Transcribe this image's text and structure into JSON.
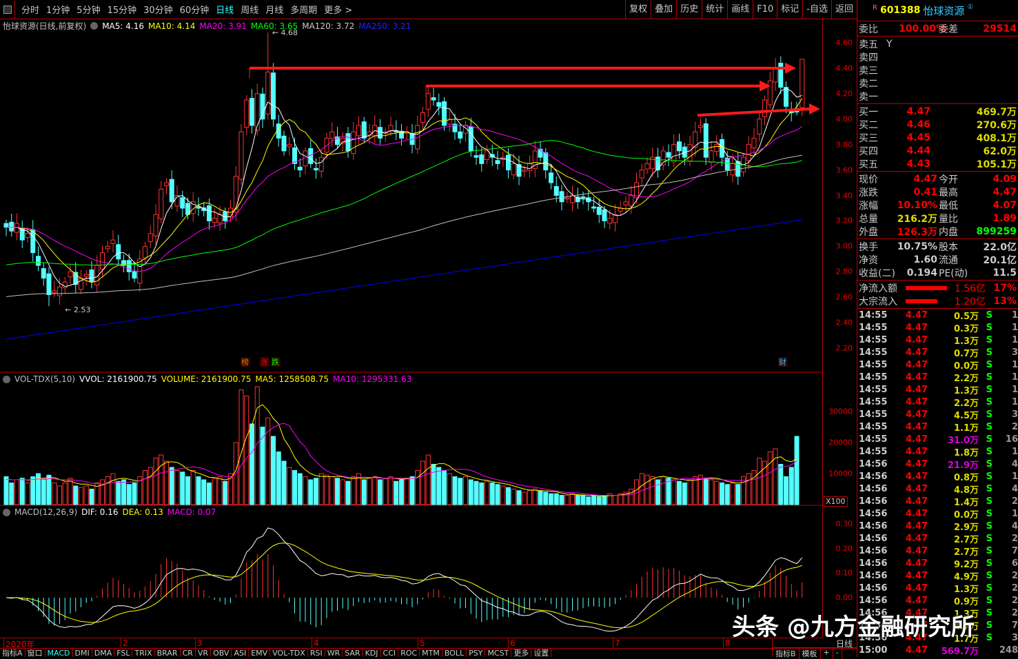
{
  "toolbar": {
    "periods": [
      "分时",
      "1分钟",
      "5分钟",
      "15分钟",
      "30分钟",
      "60分钟",
      "日线",
      "周线",
      "月线",
      "多周期",
      "更多 >"
    ],
    "active": "日线",
    "tools": [
      "复权",
      "叠加",
      "历史",
      "统计",
      "画线",
      "F10",
      "标记",
      "-自选",
      "返回"
    ]
  },
  "legend": {
    "title": "怡球资源(日线,前复权)",
    "ma5": "MA5: 4.16",
    "ma10": "MA10: 4.14",
    "ma20": "MA20: 3.91",
    "ma60": "MA60: 3.65",
    "ma120": "MA120: 3.72",
    "ma250": "MA250: 3.21",
    "high_mark": "4.68",
    "low_mark": "2.53",
    "markers": [
      "榜",
      "涨",
      "跌",
      "财"
    ]
  },
  "vol_legend": {
    "name": "VOL-TDX(5,10)",
    "vvol": "VVOL: 2161900.75",
    "volume": "VOLUME: 2161900.75",
    "ma5": "MA5: 1258508.75",
    "ma10": "MA10: 1295331.63",
    "unit": "X100"
  },
  "macd_legend": {
    "name": "MACD(12,26,9)",
    "dif": "DIF: 0.16",
    "dea": "DEA: 0.13",
    "macd": "MACD: 0.07"
  },
  "price_axis": [
    "4.60",
    "4.40",
    "4.20",
    "4.00",
    "3.80",
    "3.60",
    "3.40",
    "3.20",
    "3.00",
    "2.80",
    "2.60",
    "2.40",
    "2.20"
  ],
  "vol_axis": [
    "30000",
    "20000",
    "10000"
  ],
  "macd_axis": [
    "0.30",
    "0.20",
    "0.10",
    "0.00"
  ],
  "dates": [
    "2020年",
    "2",
    "3",
    "4",
    "5",
    "6",
    "7",
    "8"
  ],
  "bottom_tabs": [
    "指标A",
    "窗口",
    "MACD",
    "DMI",
    "DMA",
    "FSL",
    "TRIX",
    "BRAR",
    "CR",
    "VR",
    "OBV",
    "ASI",
    "EMV",
    "VOL-TDX",
    "RSI",
    "WR",
    "SAR",
    "KDJ",
    "CCI",
    "ROC",
    "MTM",
    "BOLL",
    "PSY",
    "MCST",
    "更多",
    "设置"
  ],
  "bottom_right": {
    "period": "日线",
    "tabs": [
      "指标B",
      "模板",
      "+",
      "-"
    ]
  },
  "colors": {
    "up": "#ff3232",
    "down": "#54ffff",
    "ma5": "#ffffff",
    "ma10": "#ffff00",
    "ma20": "#ff00ff",
    "ma60": "#00ff00",
    "ma120": "#c0c0c0",
    "ma250": "#0000ff",
    "arrow": "#ff1a1a"
  },
  "chart_data": {
    "type": "candlestick",
    "closes": [
      3.15,
      3.12,
      3.18,
      3.05,
      3.1,
      2.95,
      2.85,
      2.75,
      2.62,
      2.65,
      2.68,
      2.72,
      2.8,
      2.7,
      2.75,
      2.78,
      2.72,
      2.85,
      2.95,
      3.0,
      3.05,
      2.9,
      2.85,
      2.8,
      2.75,
      2.9,
      3.0,
      3.1,
      3.25,
      3.45,
      3.5,
      3.35,
      3.4,
      3.3,
      3.25,
      3.35,
      3.3,
      3.28,
      3.2,
      3.22,
      3.25,
      3.2,
      3.3,
      3.55,
      3.9,
      4.15,
      3.95,
      4.2,
      4.0,
      4.37,
      4.0,
      3.85,
      3.75,
      3.8,
      3.65,
      3.6,
      3.75,
      3.65,
      3.6,
      3.7,
      3.85,
      3.9,
      3.8,
      3.85,
      3.75,
      3.9,
      3.95,
      3.85,
      3.9,
      3.95,
      3.85,
      3.9,
      3.95,
      3.9,
      3.85,
      3.9,
      3.8,
      3.95,
      4.05,
      4.2,
      4.15,
      4.1,
      3.95,
      4.0,
      3.9,
      3.85,
      3.95,
      3.75,
      3.7,
      3.65,
      3.75,
      3.7,
      3.65,
      3.7,
      3.6,
      3.65,
      3.55,
      3.6,
      3.65,
      3.75,
      3.7,
      3.6,
      3.5,
      3.4,
      3.35,
      3.38,
      3.4,
      3.35,
      3.38,
      3.35,
      3.3,
      3.25,
      3.2,
      3.22,
      3.25,
      3.3,
      3.35,
      3.4,
      3.5,
      3.6,
      3.65,
      3.7,
      3.6,
      3.75,
      3.7,
      3.8,
      3.75,
      3.7,
      3.8,
      3.9,
      3.95,
      3.7,
      3.75,
      3.8,
      3.7,
      3.6,
      3.65,
      3.55,
      3.7,
      3.8,
      3.85,
      4.0,
      4.15,
      4.3,
      4.4,
      4.25,
      4.1,
      4.05,
      4.06,
      4.47
    ],
    "volumes": [
      9000,
      7000,
      8000,
      8500,
      7000,
      9000,
      10000,
      8000,
      9500,
      7000,
      6000,
      7000,
      8500,
      6000,
      5500,
      6000,
      5000,
      7000,
      8000,
      9000,
      10000,
      7500,
      8000,
      6500,
      7000,
      9000,
      11000,
      12000,
      15000,
      16000,
      14000,
      12000,
      11000,
      10500,
      9000,
      11000,
      9000,
      8000,
      7000,
      8500,
      9000,
      7500,
      10000,
      20000,
      37000,
      35000,
      26000,
      38000,
      25000,
      28000,
      22000,
      17000,
      14000,
      12000,
      11000,
      10000,
      9000,
      8000,
      8500,
      10000,
      9500,
      9000,
      8500,
      8000,
      7500,
      9000,
      10000,
      8000,
      8500,
      9000,
      8000,
      8500,
      9000,
      7500,
      8000,
      8500,
      9000,
      11000,
      14000,
      16000,
      13000,
      12000,
      11000,
      10000,
      9000,
      8500,
      9000,
      8000,
      7500,
      7000,
      7500,
      7000,
      6500,
      6000,
      5500,
      5000,
      4500,
      4000,
      4500,
      5000,
      4500,
      4000,
      3500,
      3500,
      3000,
      3000,
      3500,
      3000,
      3000,
      2500,
      2800,
      2500,
      3000,
      3500,
      3000,
      3500,
      4000,
      5000,
      8000,
      10000,
      9500,
      9000,
      8000,
      9000,
      8500,
      8000,
      7500,
      7000,
      8000,
      9000,
      9500,
      8500,
      8000,
      7500,
      7000,
      6500,
      7000,
      6500,
      9000,
      10000,
      11000,
      15000,
      14000,
      17000,
      18000,
      13000,
      9000,
      12000,
      22000
    ],
    "ylim": [
      2.2,
      4.6
    ]
  },
  "quote": {
    "code": "601388",
    "name": "怡球资源",
    "weibi_label": "委比",
    "weibi": "100.00%",
    "weicha_label": "委差",
    "weicha": "29514",
    "sells": [
      {
        "label": "卖五",
        "extra": "Y"
      },
      {
        "label": "卖四"
      },
      {
        "label": "卖三"
      },
      {
        "label": "卖二"
      },
      {
        "label": "卖一"
      }
    ],
    "buys": [
      {
        "label": "买一",
        "price": "4.47",
        "vol": "469.7万"
      },
      {
        "label": "买二",
        "price": "4.46",
        "vol": "270.6万"
      },
      {
        "label": "买三",
        "price": "4.45",
        "vol": "408.1万"
      },
      {
        "label": "买四",
        "price": "4.44",
        "vol": "62.0万"
      },
      {
        "label": "买五",
        "price": "4.43",
        "vol": "105.1万"
      }
    ],
    "stats": [
      [
        "现价",
        "4.47",
        "今开",
        "4.09"
      ],
      [
        "涨跌",
        "0.41",
        "最高",
        "4.47"
      ],
      [
        "涨幅",
        "10.10%",
        "最低",
        "4.07"
      ],
      [
        "总量",
        "216.2万",
        "量比",
        "1.89"
      ],
      [
        "外盘",
        "126.3万",
        "内盘",
        "899259"
      ]
    ],
    "stats2": [
      [
        "换手",
        "10.75%",
        "股本",
        "22.0亿"
      ],
      [
        "净资",
        "1.60",
        "流通",
        "20.1亿"
      ],
      [
        "收益(二)",
        "0.194",
        "PE(动)",
        "11.5"
      ]
    ],
    "flows": [
      {
        "label": "净流入额",
        "value": "1.56亿",
        "pct": "17%",
        "bar": 1.0
      },
      {
        "label": "大宗流入",
        "value": "1.20亿",
        "pct": "13%",
        "bar": 0.77
      }
    ]
  },
  "ticks": [
    [
      "14:55",
      "4.47",
      "0.5万",
      "S",
      "1"
    ],
    [
      "14:55",
      "4.47",
      "0.3万",
      "S",
      "1"
    ],
    [
      "14:55",
      "4.47",
      "1.3万",
      "S",
      "1"
    ],
    [
      "14:55",
      "4.47",
      "0.7万",
      "S",
      "3"
    ],
    [
      "14:55",
      "4.47",
      "0.0万",
      "S",
      "1"
    ],
    [
      "14:55",
      "4.47",
      "2.2万",
      "S",
      "1"
    ],
    [
      "14:55",
      "4.47",
      "1.3万",
      "S",
      "1"
    ],
    [
      "14:55",
      "4.47",
      "2.2万",
      "S",
      "1"
    ],
    [
      "14:55",
      "4.47",
      "4.5万",
      "S",
      "3"
    ],
    [
      "14:55",
      "4.47",
      "1.1万",
      "S",
      "2"
    ],
    [
      "14:55",
      "4.47",
      "31.0万",
      "S",
      "16"
    ],
    [
      "14:55",
      "4.47",
      "1.8万",
      "S",
      "1"
    ],
    [
      "14:56",
      "4.47",
      "21.9万",
      "S",
      "4"
    ],
    [
      "14:56",
      "4.47",
      "0.8万",
      "S",
      "1"
    ],
    [
      "14:56",
      "4.47",
      "4.8万",
      "S",
      "4"
    ],
    [
      "14:56",
      "4.47",
      "1.4万",
      "S",
      "2"
    ],
    [
      "14:56",
      "4.47",
      "0.0万",
      "S",
      "1"
    ],
    [
      "14:56",
      "4.47",
      "2.9万",
      "S",
      "4"
    ],
    [
      "14:56",
      "4.47",
      "2.7万",
      "S",
      "2"
    ],
    [
      "14:56",
      "4.47",
      "2.7万",
      "S",
      "7"
    ],
    [
      "14:56",
      "4.47",
      "9.2万",
      "S",
      "6"
    ],
    [
      "14:56",
      "4.47",
      "4.9万",
      "S",
      "2"
    ],
    [
      "14:56",
      "4.47",
      "1.3万",
      "S",
      "2"
    ],
    [
      "14:56",
      "4.47",
      "0.9万",
      "S",
      "2"
    ],
    [
      "14:56",
      "4.47",
      "1.3万",
      "S",
      "2"
    ],
    [
      "14:56",
      "4.47",
      "4.7万",
      "S",
      "7"
    ],
    [
      "14:56",
      "4.47",
      "1.7万",
      "S",
      "3"
    ],
    [
      "15:00",
      "4.47",
      "569.7万",
      "",
      "248"
    ]
  ],
  "watermark": "头条 @九方金融研究所"
}
